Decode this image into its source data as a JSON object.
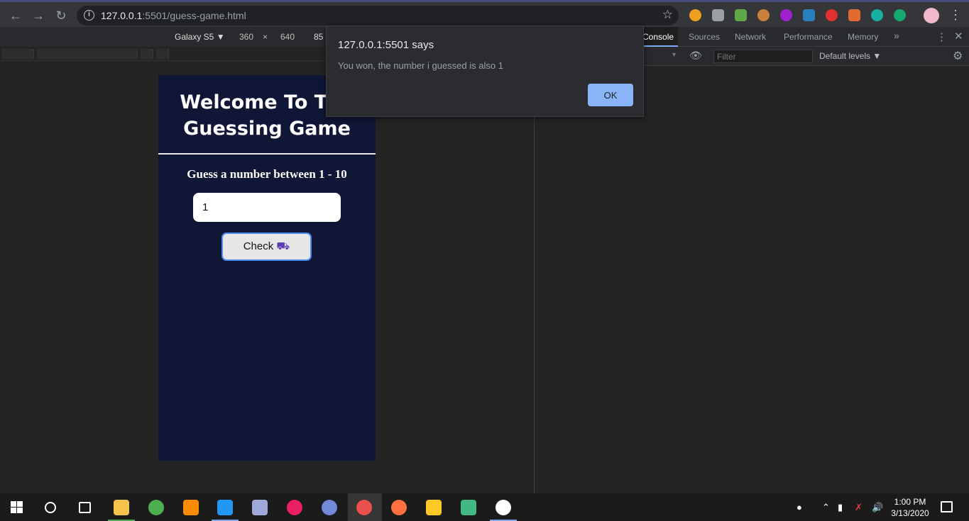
{
  "browser": {
    "url_host": "127.0.0.1",
    "url_rest": ":5501/guess-game.html"
  },
  "device_toolbar": {
    "device": "Galaxy S5 ▼",
    "width": "360",
    "times": "×",
    "height": "640",
    "zoom": "85"
  },
  "devtools": {
    "tabs": [
      "Console",
      "Sources",
      "Network",
      "Performance",
      "Memory"
    ],
    "more": "»",
    "filter_placeholder": "Filter",
    "levels": "Default levels ▼"
  },
  "page": {
    "title": "Welcome To The Guessing Game",
    "prompt": "Guess a number between 1 - 10",
    "input_value": "1",
    "check_label": "Check"
  },
  "alert": {
    "title": "127.0.0.1:5501 says",
    "message": "You won, the number i guessed is also 1",
    "ok": "OK"
  },
  "taskbar": {
    "time": "1:00 PM",
    "date": "3/13/2020"
  }
}
